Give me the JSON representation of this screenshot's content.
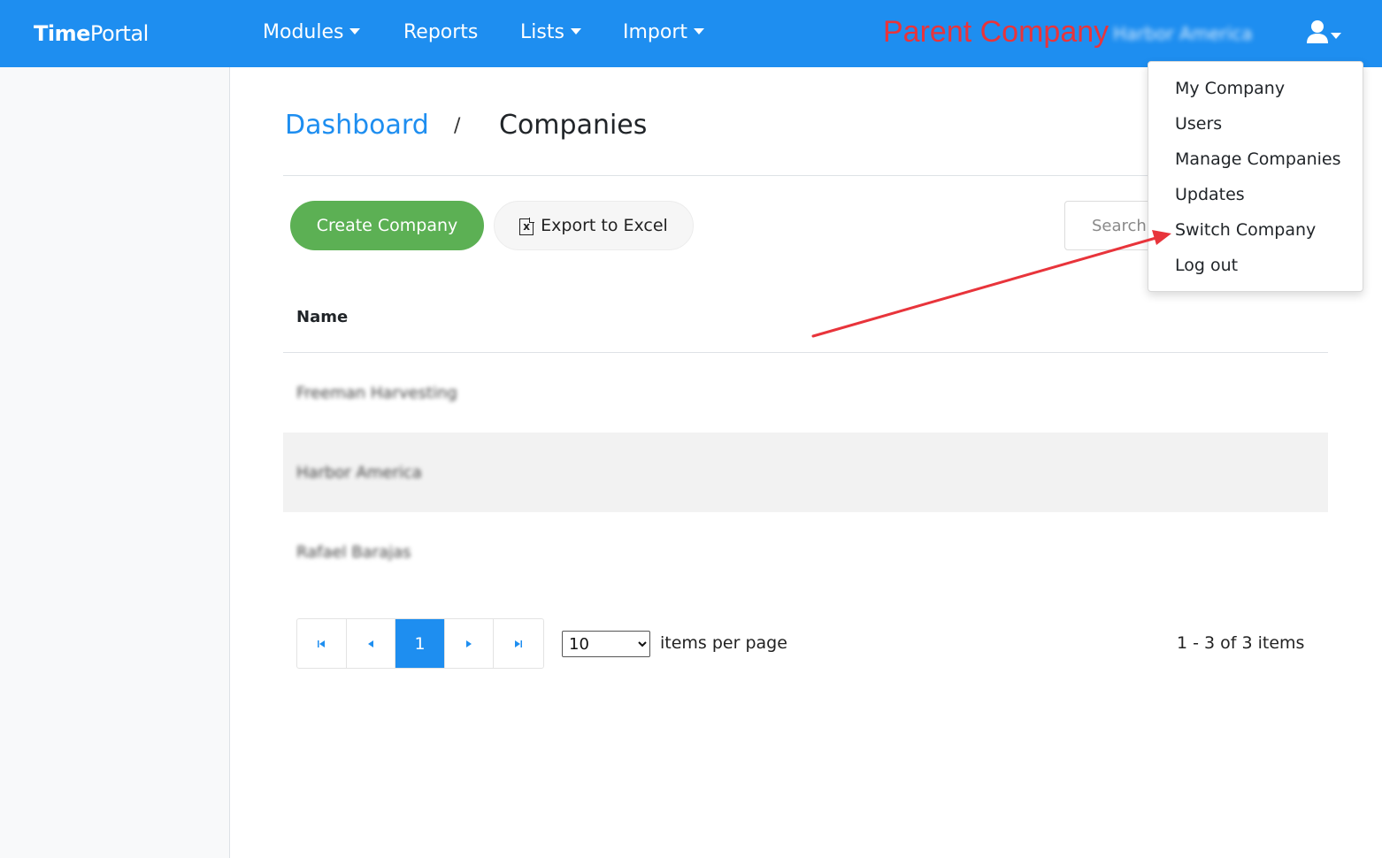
{
  "navbar": {
    "brand_bold": "Time",
    "brand_rest": "Portal",
    "modules": "Modules",
    "reports": "Reports",
    "lists": "Lists",
    "import": "Import",
    "parent_company_label": "Parent Company",
    "parent_company_value": "Harbor America",
    "user_icon": "user-icon",
    "color": "#1e8ef0"
  },
  "breadcrumb": {
    "dashboard": "Dashboard",
    "separator": "/",
    "current": "Companies"
  },
  "toolbar": {
    "create_label": "Create Company",
    "export_label": "Export to Excel",
    "export_icon": "excel-file-icon",
    "search_placeholder": "Search..."
  },
  "table": {
    "header_name": "Name",
    "rows": [
      {
        "name": "Freeman Harvesting"
      },
      {
        "name": "Harbor America"
      },
      {
        "name": "Rafael Barajas"
      }
    ]
  },
  "pager": {
    "current_page": "1",
    "page_size": "10",
    "page_size_options": [
      "10"
    ],
    "per_page_label": "items per page",
    "items_info": "1 - 3 of 3 items"
  },
  "user_menu": {
    "items": [
      "My Company",
      "Users",
      "Manage Companies",
      "Updates",
      "Switch Company",
      "Log out"
    ]
  },
  "annotation": {
    "arrow_color": "#e8343b"
  }
}
